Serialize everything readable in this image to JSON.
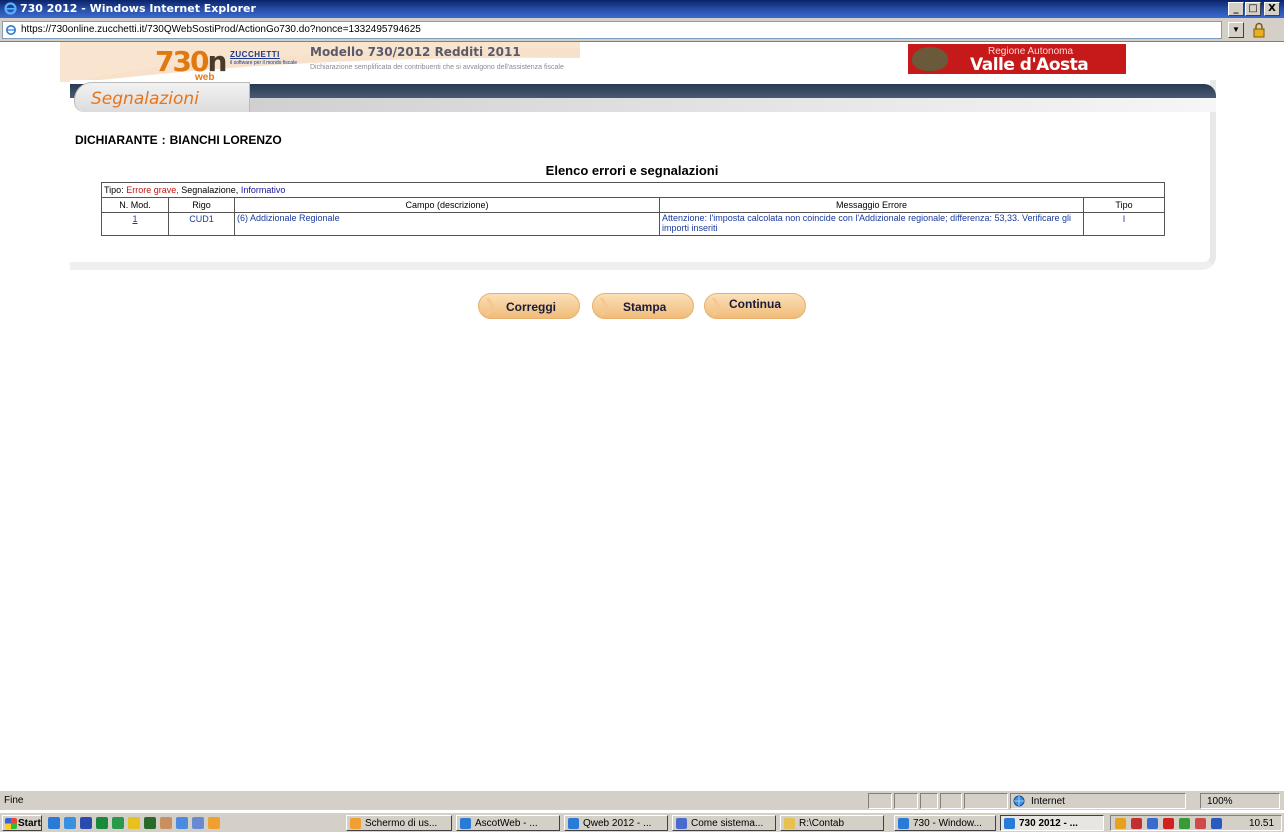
{
  "window": {
    "title": "730 2012 - Windows Internet Explorer",
    "min": "_",
    "max": "□",
    "close": "X"
  },
  "address": {
    "url": "https://730online.zucchetti.it/730QWebSostiProd/ActionGo730.do?nonce=1332495794625"
  },
  "banner": {
    "logo_730": "730",
    "logo_on": "n",
    "logo_web": "web",
    "brand": "ZUCCHETTI",
    "brand_sub": "il software per il mondo fiscale",
    "modello": "Modello 730/2012 Redditi 2011",
    "subtitle": "Dichiarazione semplificata dei contribuenti che si avvalgono dell'assistenza fiscale",
    "region_top": "Regione Autonoma",
    "region_name": "Valle d'Aosta"
  },
  "page": {
    "section_tab": "Segnalazioni",
    "dichiarante_label": "DICHIARANTE",
    "dichiarante_sep": ":",
    "dichiarante_name": "BIANCHI LORENZO",
    "heading": "Elenco errori e segnalazioni"
  },
  "table": {
    "legend_prefix": "Tipo:",
    "legend_e": "Errore grave,",
    "legend_s": "Segnalazione,",
    "legend_i": "Informativo",
    "columns": [
      "N. Mod.",
      "Rigo",
      "Campo (descrizione)",
      "Messaggio Errore",
      "Tipo"
    ],
    "rows": [
      {
        "mod": "1",
        "rigo": "CUD1",
        "campo": "(6) Addizionale Regionale",
        "messaggio": "Attenzione: l'imposta calcolata non coincide con l'Addizionale regionale; differenza: 53,33. Verificare gli importi inseriti",
        "tipo": "I"
      }
    ]
  },
  "buttons": {
    "correggi": "Correggi",
    "stampa": "Stampa",
    "continua": "Continua"
  },
  "statusbar": {
    "status": "Fine",
    "zone": "Internet",
    "zoom": "100%"
  },
  "taskbar": {
    "start": "Start",
    "tasks": [
      "Schermo di us...",
      "AscotWeb - ...",
      "Qweb 2012 - ...",
      "Come sistema...",
      "R:\\Contab",
      "730 - Window...",
      "730 2012 - ..."
    ],
    "clock": "10.51"
  },
  "colors": {
    "accent_orange": "#e8741a",
    "region_red": "#c61a1a",
    "link_blue": "#1a3aa0",
    "error_red": "#c81414"
  }
}
